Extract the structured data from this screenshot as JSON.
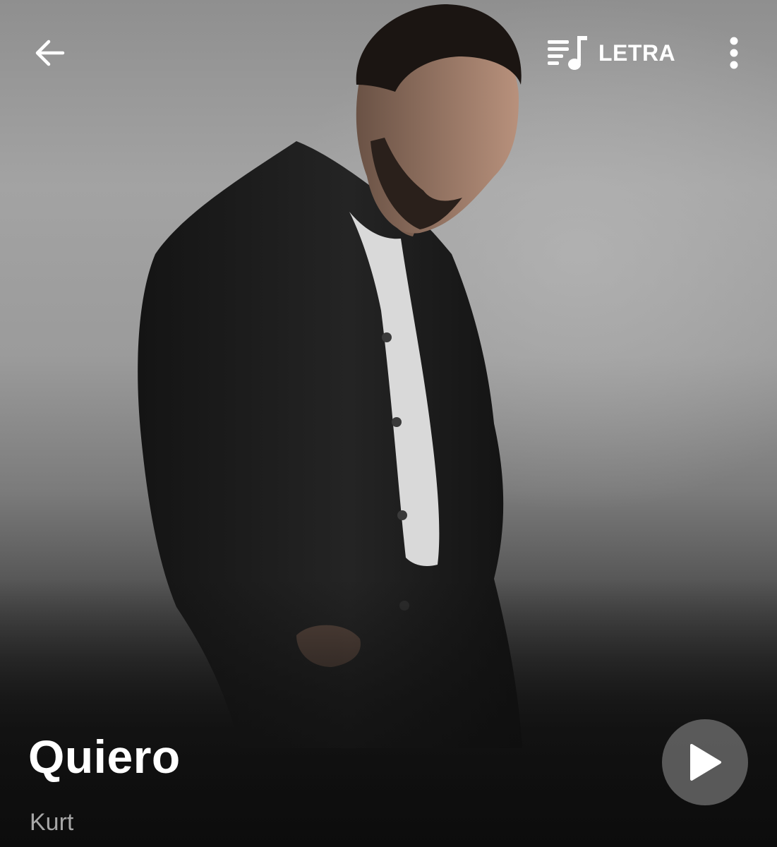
{
  "header": {
    "back_icon": "arrow-left-icon",
    "lyrics_icon": "lyrics-note-icon",
    "lyrics_label": "LETRA",
    "more_icon": "more-vertical-icon"
  },
  "song": {
    "title": "Quiero",
    "artist": "Kurt"
  },
  "player": {
    "play_icon": "play-icon"
  },
  "colors": {
    "text_primary": "#ffffff",
    "text_secondary": "#a7a7a7",
    "play_button_bg": "#6e6e6e"
  }
}
